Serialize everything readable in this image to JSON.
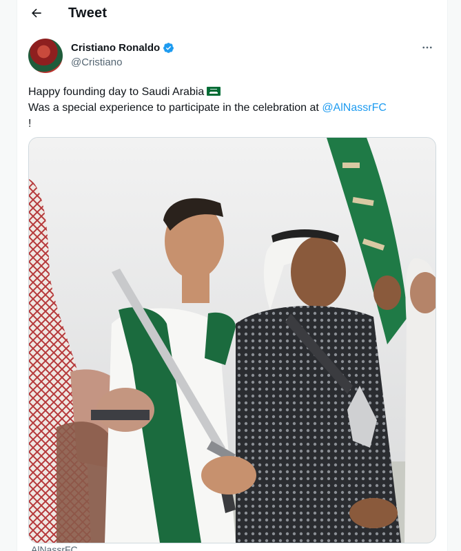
{
  "header": {
    "title": "Tweet",
    "back_icon": "arrow-left-icon"
  },
  "author": {
    "name": "Cristiano Ronaldo",
    "handle": "@Cristiano",
    "verified": true
  },
  "tweet": {
    "line1": "Happy founding day to Saudi Arabia",
    "line2_prefix": "Was a special experience to participate in the celebration at ",
    "mention": "@AlNassrFC",
    "line3": "!"
  },
  "footer": {
    "partial_text": "AlNassrFC"
  },
  "colors": {
    "accent": "#1d9bf0",
    "text": "#0f1419",
    "secondary": "#536471",
    "flag_green": "#006c35"
  }
}
